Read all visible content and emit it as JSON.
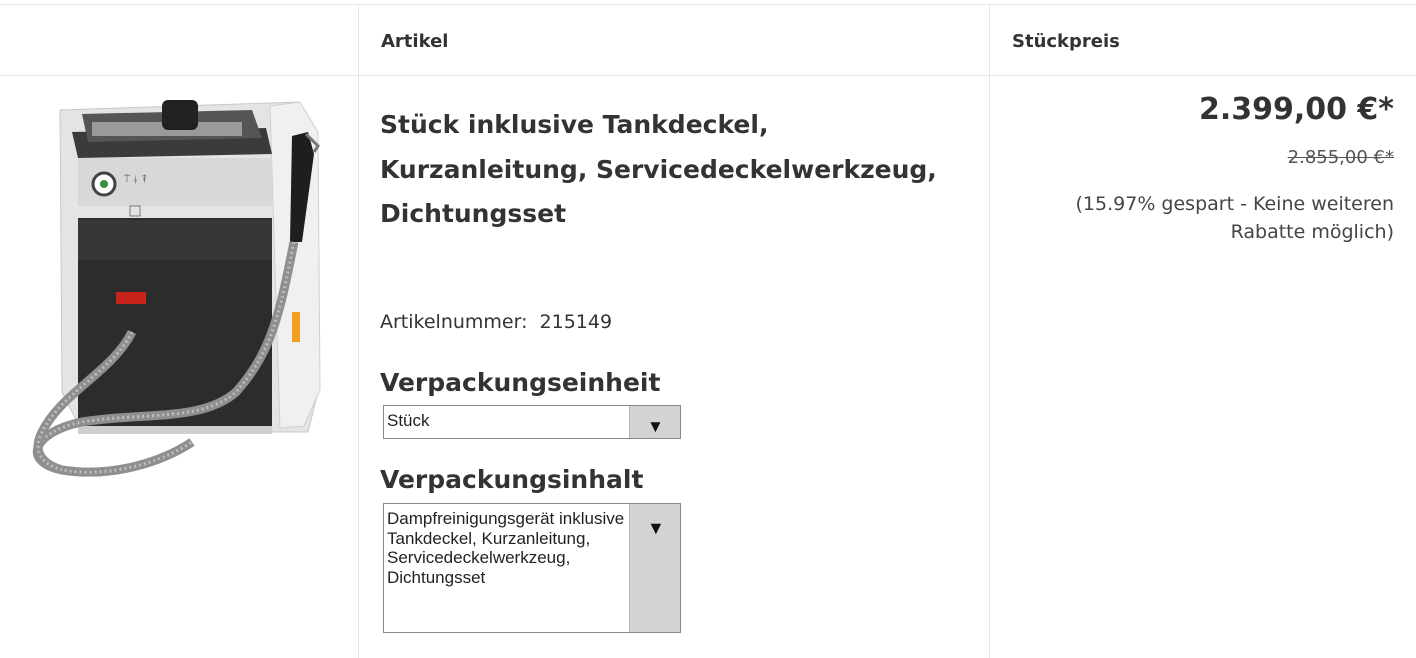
{
  "table": {
    "header": {
      "article": "Artikel",
      "unit_price": "Stückpreis"
    }
  },
  "product": {
    "image_icon": "dental-steam-cleaner-image",
    "title": "Stück inklusive Tankdeckel, Kurzanleitung, Servicedeckelwerkzeug, Dichtungsset",
    "article_number_label": "Artikelnummer:",
    "article_number": "215149",
    "packaging_unit_label": "Verpackungseinheit",
    "packaging_unit_value": "Stück",
    "packaging_content_label": "Verpackungsinhalt",
    "packaging_content_value": "Dampfreinigungsgerät inklusive Tankdeckel, Kurzanleitung, Servicedeckelwerkzeug, Dichtungsset",
    "dropdown_icon": "triangle-down-icon"
  },
  "pricing": {
    "price": "2.399,00 €*",
    "old_price": "2.855,00 €*",
    "saving_note": "(15.97% gespart - Keine weiteren Rabatte möglich)"
  },
  "colors": {
    "text": "#333333",
    "border": "#e6e6e6",
    "select_button": "#d3d3d3"
  }
}
